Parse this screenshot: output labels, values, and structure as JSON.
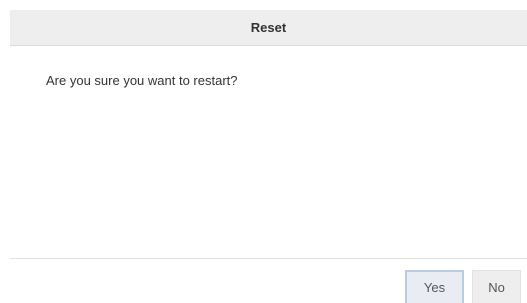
{
  "dialog": {
    "title": "Reset",
    "message": "Are you sure you want to restart?",
    "buttons": {
      "yes_label": "Yes",
      "no_label": "No"
    }
  }
}
